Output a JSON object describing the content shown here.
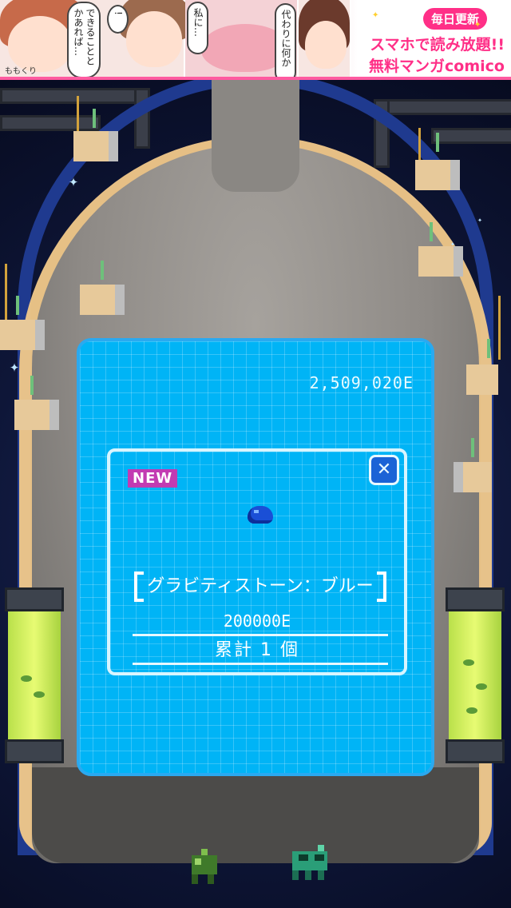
{
  "ad": {
    "author": "ももくり",
    "bubble1": "できることとかあれば…",
    "bubble2": "!",
    "bubble3": "私に…",
    "bubble4": "代わりに何か",
    "badge": "毎日更新",
    "line1": "スマホで読み放題!!",
    "line2": "無料マンガcomico"
  },
  "hud": {
    "energy": "2,509,020E"
  },
  "dialog": {
    "new_badge": "NEW",
    "close_label": "✕",
    "item_name": "グラビティストーン：ブルー",
    "item_price": "200000E",
    "item_count": "累計 1 個"
  },
  "colors": {
    "panel": "#00b4f6",
    "badge_new": "#c23bb2",
    "close_button": "#1b63d6",
    "item_icon": "#1a4fd6",
    "ad_accent": "#ff2f87"
  }
}
